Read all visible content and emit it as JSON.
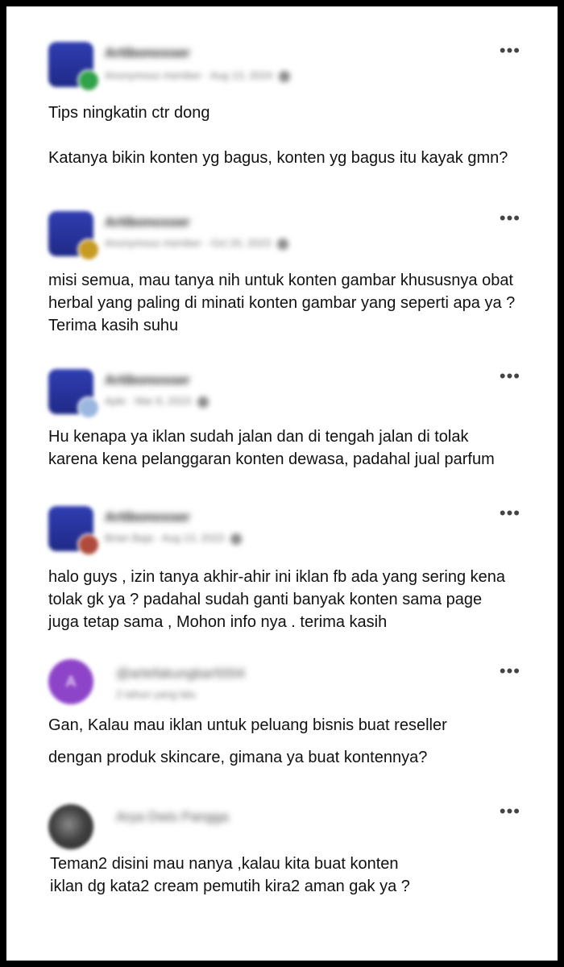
{
  "posts": [
    {
      "author": "Artibonosser",
      "meta": "Anonymous member · Aug 13, 2024",
      "badge_color": "#2fa24a",
      "more_label": "•••",
      "text": "Tips ningkatin ctr dong\n\nKatanya bikin konten yg bagus, konten yg bagus itu kayak gmn?"
    },
    {
      "author": "Artibonosser",
      "meta": "Anonymous member · Oct 20, 2023",
      "badge_color": "#c79a22",
      "more_label": "•••",
      "text": "misi semua, mau tanya nih untuk konten gambar khususnya obat herbal yang paling di minati konten gambar yang seperti apa ya ? Terima kasih suhu"
    },
    {
      "author": "Artibonosser",
      "meta": "Aple · Mar 8, 2023",
      "badge_color": "#9bb7e0",
      "more_label": "•••",
      "text": "Hu kenapa ya iklan sudah jalan dan di tengah jalan di tolak karena kena pelanggaran konten dewasa, padahal jual parfum"
    },
    {
      "author": "Artibonosser",
      "meta": "Brian Baja · Aug 13, 2023",
      "badge_color": "#b04a3c",
      "more_label": "•••",
      "text": "halo guys , izin tanya akhir-ahir ini iklan fb ada yang sering kena tolak gk ya ? padahal sudah ganti banyak konten sama page juga tetap sama , Mohon info nya . terima kasih"
    },
    {
      "author": "@artefakungbar5004",
      "meta": "2 tahun yang lalu",
      "avatar_letter": "A",
      "avatar_color": "#8e44c9",
      "more_label": "•••",
      "text": "Gan, Kalau mau iklan untuk peluang bisnis buat reseller\n\ndengan produk skincare, gimana ya buat kontennya?"
    },
    {
      "author": "Arya Dwis Pangga",
      "avatar_color": "#555555",
      "more_label": "•••",
      "text": "Teman2 disini mau nanya ,kalau kita buat konten\niklan dg kata2  cream pemutih kira2 aman gak ya ?"
    }
  ]
}
